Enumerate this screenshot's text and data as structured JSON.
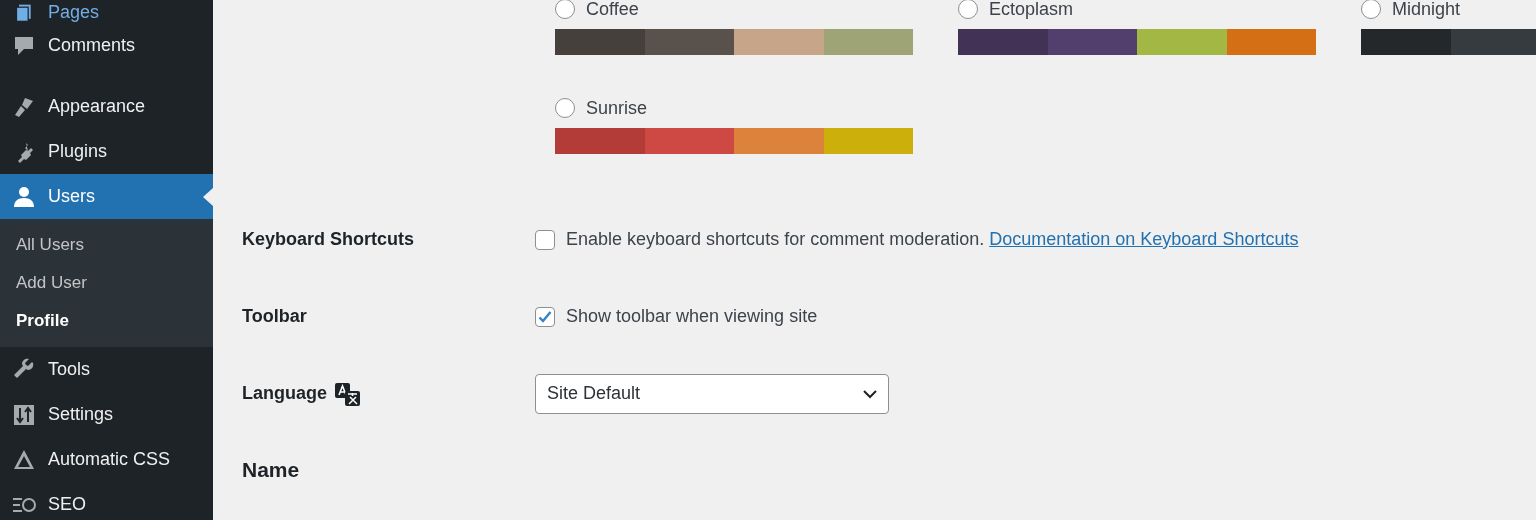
{
  "sidebar": {
    "groups": [
      [
        {
          "label": "Pages",
          "highlighted": true,
          "selected": false
        },
        {
          "label": "Comments",
          "highlighted": false,
          "selected": false
        }
      ],
      [
        {
          "label": "Appearance",
          "highlighted": false,
          "selected": false
        },
        {
          "label": "Plugins",
          "highlighted": false,
          "selected": false
        },
        {
          "label": "Users",
          "highlighted": false,
          "selected": true,
          "children": [
            {
              "label": "All Users",
              "selected": false
            },
            {
              "label": "Add User",
              "selected": false
            },
            {
              "label": "Profile",
              "selected": true
            }
          ]
        },
        {
          "label": "Tools",
          "highlighted": false,
          "selected": false
        },
        {
          "label": "Settings",
          "highlighted": false,
          "selected": false
        },
        {
          "label": "Automatic CSS",
          "highlighted": false,
          "selected": false
        },
        {
          "label": "SEO",
          "highlighted": false,
          "selected": false
        }
      ]
    ]
  },
  "color_schemes": [
    {
      "name": "Coffee",
      "selected": false,
      "swatches": [
        {
          "color": "#46403c"
        },
        {
          "color": "#59524c"
        },
        {
          "color": "#c7a589"
        },
        {
          "color": "#9ea476"
        }
      ]
    },
    {
      "name": "Ectoplasm",
      "selected": false,
      "swatches": [
        {
          "color": "#413256"
        },
        {
          "color": "#523f6d"
        },
        {
          "color": "#a3b745"
        },
        {
          "color": "#d46f15"
        }
      ]
    },
    {
      "name": "Midnight",
      "selected": false,
      "swatches": [
        {
          "color": "#25282b"
        },
        {
          "color": "#363b3f"
        }
      ]
    },
    {
      "name": "Sunrise",
      "selected": false,
      "swatches": [
        {
          "color": "#b43c38"
        },
        {
          "color": "#cf4944"
        },
        {
          "color": "#dd823b"
        },
        {
          "color": "#ccaf0b"
        }
      ]
    }
  ],
  "settings": [
    {
      "kind": "checkbox",
      "label": "Keyboard Shortcuts",
      "text": "Enable keyboard shortcuts for comment moderation.",
      "link": "Documentation on Keyboard Shortcuts",
      "checked": false
    },
    {
      "kind": "checkbox",
      "label": "Toolbar",
      "text": "Show toolbar when viewing site",
      "checked": true
    },
    {
      "kind": "select",
      "label": "Language",
      "value": "Site Default"
    }
  ],
  "section_heading": "Name"
}
